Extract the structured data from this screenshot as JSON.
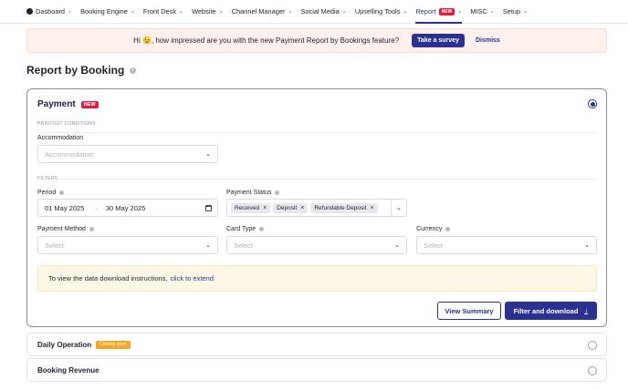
{
  "nav": {
    "items": [
      {
        "label": "Dasboard",
        "has_logo": true
      },
      {
        "label": "Booking Engine"
      },
      {
        "label": "Front Desk"
      },
      {
        "label": "Website"
      },
      {
        "label": "Channel Manager"
      },
      {
        "label": "Social Media"
      },
      {
        "label": "Upselling Tools"
      },
      {
        "label": "Report",
        "active": true,
        "badge": "NEW"
      },
      {
        "label": "MISC"
      },
      {
        "label": "Setup"
      }
    ]
  },
  "banner": {
    "text": "Hi 😉, how impressed are you with the new Payment Report by Bookings feature?",
    "survey_label": "Take a survey",
    "dismiss_label": "Dismiss"
  },
  "page": {
    "title": "Report by Booking"
  },
  "payment_card": {
    "title": "Payment",
    "badge": "NEW",
    "printout_label": "PRINTOUT CONDITIONS",
    "accommodation_label": "Accommodation",
    "accommodation_placeholder": "Accommodation",
    "filters_label": "FILTERS",
    "period_label": "Period",
    "period_start": "01 May 2025",
    "period_end": "30 May 2025",
    "payment_status_label": "Payment Status",
    "status_tags": [
      "Received",
      "Deposit",
      "Refundable Deposit"
    ],
    "payment_method_label": "Payment Method",
    "payment_method_placeholder": "Select",
    "card_type_label": "Card Type",
    "card_type_placeholder": "Select",
    "currency_label": "Currency",
    "currency_placeholder": "Select",
    "notice_text": "To view the data download instructions,",
    "notice_link": "click to extend",
    "view_summary_label": "View Summary",
    "filter_download_label": "Filter and download"
  },
  "daily_operation": {
    "title": "Daily Operation",
    "badge": "Coming soon"
  },
  "booking_revenue": {
    "title": "Booking Revenue"
  },
  "colors": {
    "primary": "#2a3190",
    "new_badge": "#e31b3c",
    "coming_badge": "#f5a623"
  }
}
